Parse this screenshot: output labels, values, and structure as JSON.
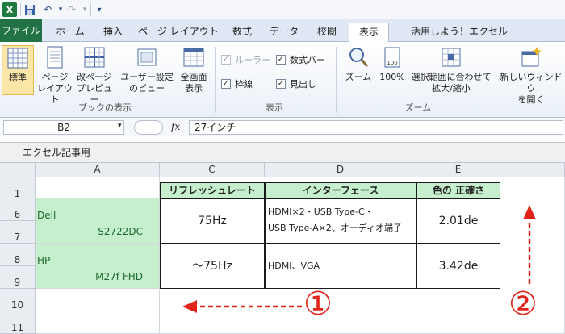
{
  "qat": {
    "excel_icon": "excel-logo-icon",
    "save_icon": "save-icon",
    "undo_icon": "undo-icon",
    "redo_icon": "redo-icon",
    "customize_icon": "customize-qat-icon"
  },
  "tabs": [
    {
      "label": "ファイル"
    },
    {
      "label": "ホーム"
    },
    {
      "label": "挿入"
    },
    {
      "label": "ページ レイアウト"
    },
    {
      "label": "数式"
    },
    {
      "label": "データ"
    },
    {
      "label": "校閲"
    },
    {
      "label": "表示"
    },
    {
      "label": "活用しよう！エクセル"
    }
  ],
  "ribbon": {
    "views": {
      "normal": "標準",
      "page_layout_1": "ページ",
      "page_layout_2": "レイアウト",
      "page_break_1": "改ページ",
      "page_break_2": "プレビュー",
      "custom_1": "ユーザー設定",
      "custom_2": "のビュー",
      "full_1": "全画面",
      "full_2": "表示",
      "group": "ブックの表示"
    },
    "show": {
      "ruler": "ルーラー",
      "formula_bar": "数式バー",
      "gridlines": "枠線",
      "headings": "見出し",
      "group": "表示",
      "check": "✓"
    },
    "zoom": {
      "zoom": "ズーム",
      "hundred": "100%",
      "fit_1": "選択範囲に合わせて",
      "fit_2": "拡大/縮小",
      "group": "ズーム",
      "badge": "100"
    },
    "window": {
      "new_1": "新しいウィンドウ",
      "new_2": "を開く"
    }
  },
  "formula_bar": {
    "name_box": "B2",
    "fx": "fx",
    "value": "27インチ"
  },
  "workbook": {
    "title": "エクセル記事用",
    "icon": "X"
  },
  "grid": {
    "columns": [
      "A",
      "C",
      "D",
      "E"
    ],
    "row_numbers": [
      "1",
      "6",
      "7",
      "8",
      "9",
      "10",
      "11"
    ],
    "headers": {
      "c": "リフレッシュレート",
      "d": "インターフェース",
      "e": "色の 正確さ"
    },
    "rows": [
      {
        "maker": "Dell",
        "model": "S2722DC",
        "refresh": "75Hz",
        "interface_1": "HDMI×2・USB Type-C・",
        "interface_2": "USB Type-A×2、オーディオ端子",
        "color": "2.01de"
      },
      {
        "maker": "HP",
        "model": "M27f FHD",
        "refresh": "～75Hz",
        "interface_1": "HDMI、VGA",
        "interface_2": "",
        "color": "3.42de"
      }
    ]
  },
  "annotations": {
    "one": "①",
    "two": "②",
    "color": "#e2231a"
  }
}
